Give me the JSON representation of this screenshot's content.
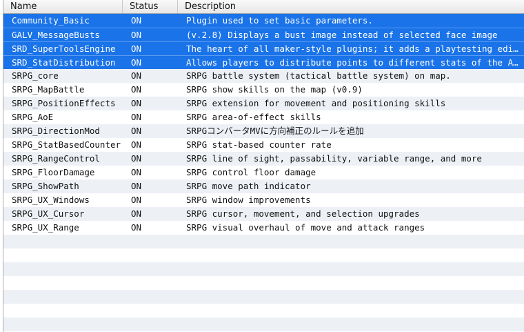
{
  "columns": {
    "name": "Name",
    "status": "Status",
    "description": "Description"
  },
  "plugins": [
    {
      "name": "Community_Basic",
      "status": "ON",
      "description": "Plugin used to set basic parameters.",
      "selected": true
    },
    {
      "name": "GALV_MessageBusts",
      "status": "ON",
      "description": "(v.2.8) Displays a bust image instead of selected face image",
      "selected": true
    },
    {
      "name": "SRD_SuperToolsEngine",
      "status": "ON",
      "description": "The heart of all maker-style plugins; it adds a playtesting editor that allows developers to edit their game during runtime.",
      "selected": true
    },
    {
      "name": "SRD_StatDistribution",
      "status": "ON",
      "description": "Allows players to distribute points to different stats of the Actors in the party.",
      "selected": true
    },
    {
      "name": "SRPG_core",
      "status": "ON",
      "description": "SRPG battle system (tactical battle system) on map.",
      "selected": false
    },
    {
      "name": "SRPG_MapBattle",
      "status": "ON",
      "description": "SRPG show skills on the map (v0.9)",
      "selected": false
    },
    {
      "name": "SRPG_PositionEffects",
      "status": "ON",
      "description": "SRPG extension for movement and positioning skills",
      "selected": false
    },
    {
      "name": "SRPG_AoE",
      "status": "ON",
      "description": "SRPG area-of-effect skills",
      "selected": false
    },
    {
      "name": "SRPG_DirectionMod",
      "status": "ON",
      "description": "SRPGコンバータMVに方向補正のルールを追加",
      "selected": false
    },
    {
      "name": "SRPG_StatBasedCounter",
      "status": "ON",
      "description": "SRPG stat-based counter rate",
      "selected": false
    },
    {
      "name": "SRPG_RangeControl",
      "status": "ON",
      "description": "SRPG line of sight, passability, variable range, and more",
      "selected": false
    },
    {
      "name": "SRPG_FloorDamage",
      "status": "ON",
      "description": "SRPG control floor damage",
      "selected": false
    },
    {
      "name": "SRPG_ShowPath",
      "status": "ON",
      "description": "SRPG move path indicator",
      "selected": false
    },
    {
      "name": "SRPG_UX_Windows",
      "status": "ON",
      "description": "SRPG window improvements",
      "selected": false
    },
    {
      "name": "SRPG_UX_Cursor",
      "status": "ON",
      "description": "SRPG cursor, movement, and selection upgrades",
      "selected": false
    },
    {
      "name": "SRPG_UX_Range",
      "status": "ON",
      "description": "SRPG visual overhaul of move and attack ranges",
      "selected": false
    }
  ],
  "colors": {
    "selection": "#1a73e8",
    "stripe": "#edf1f6",
    "header": "#e6e6e6"
  }
}
